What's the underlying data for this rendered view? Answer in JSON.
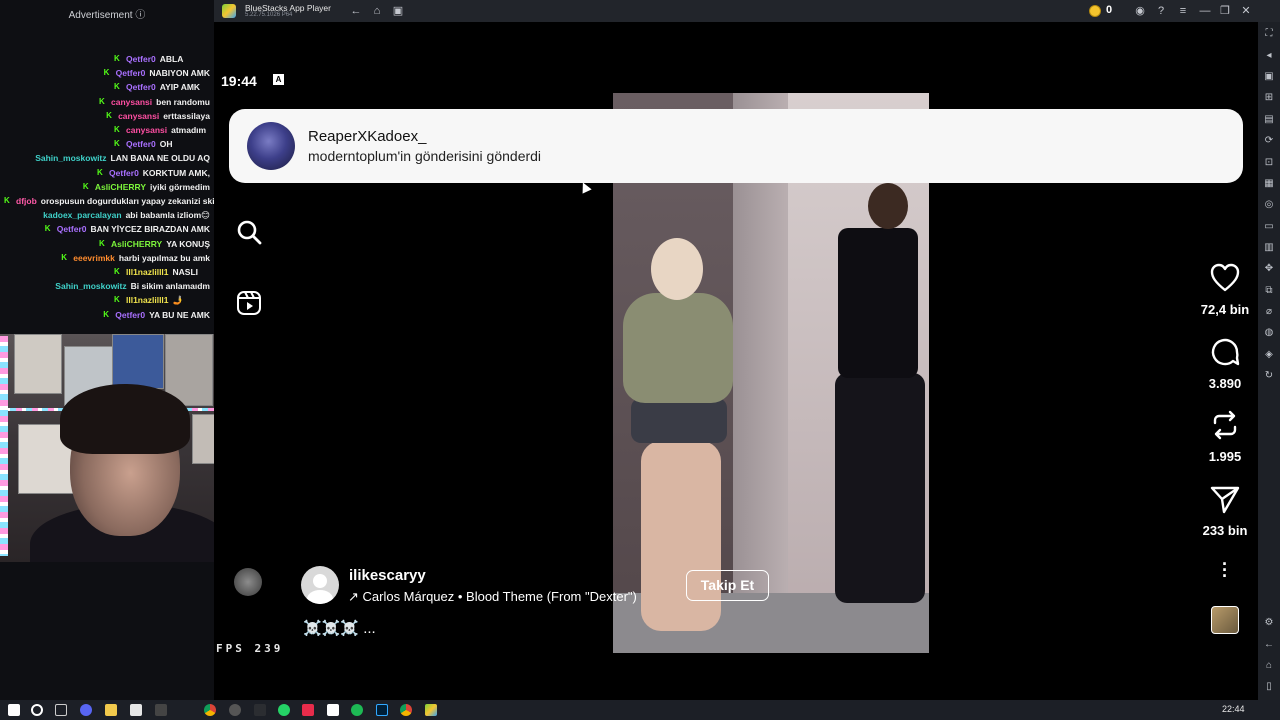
{
  "chat": {
    "ad_label": "Advertisement ⓘ",
    "messages": [
      {
        "user": "Qetfer0",
        "text": "ABLA",
        "color": "#a970ff",
        "badge": true
      },
      {
        "user": "Qetfer0",
        "text": "NABIYON AMK",
        "color": "#a970ff",
        "badge": true
      },
      {
        "user": "Qetfer0",
        "text": "AYIP AMK",
        "color": "#a970ff",
        "badge": true
      },
      {
        "user": "canysansi",
        "text": "ben randomu",
        "color": "#ff4fa3",
        "badge": true
      },
      {
        "user": "canysansi",
        "text": "erttassilaya",
        "color": "#ff4fa3",
        "badge": true
      },
      {
        "user": "canysansi",
        "text": "atmadım",
        "color": "#ff4fa3",
        "badge": true
      },
      {
        "user": "Qetfer0",
        "text": "OH",
        "color": "#a970ff",
        "badge": true
      },
      {
        "user": "Sahin_moskowitz",
        "text": "LAN BANA NE OLDU AQ",
        "color": "#3fd1c9",
        "badge": false
      },
      {
        "user": "Qetfer0",
        "text": "KORKTUM AMK,",
        "color": "#a970ff",
        "badge": true
      },
      {
        "user": "AsliCHERRY",
        "text": "iyiki görmedim",
        "color": "#7cf53b",
        "badge": true
      },
      {
        "user": "dfjob",
        "text": "orospusun dogurdukları yapay zekanizi skim",
        "color": "#ff5aa8",
        "badge": true
      },
      {
        "user": "kadoex_parcalayan",
        "text": "abi babamla izliom😊",
        "color": "#3fd1c9",
        "badge": false
      },
      {
        "user": "Qetfer0",
        "text": "BAN YİYCEZ BIRAZDAN AMK",
        "color": "#a970ff",
        "badge": true
      },
      {
        "user": "AsliCHERRY",
        "text": "YA KONUŞ",
        "color": "#7cf53b",
        "badge": true
      },
      {
        "user": "eeevrimkk",
        "text": "harbi yapılmaz bu amk",
        "color": "#ff8c2e",
        "badge": true
      },
      {
        "user": "lll1nazlilll1",
        "text": "NASLI",
        "color": "#f0e34c",
        "badge": true
      },
      {
        "user": "Sahin_moskowitz",
        "text": "Bi sikim anlamaıdm",
        "color": "#3fd1c9",
        "badge": false
      },
      {
        "user": "lll1nazlilll1",
        "text": "🤳",
        "color": "#f0e34c",
        "badge": true
      },
      {
        "user": "Qetfer0",
        "text": "YA BU NE AMK",
        "color": "#a970ff",
        "badge": true
      }
    ]
  },
  "bluestacks": {
    "title": "BlueStacks App Player",
    "version": "5.22.75.1026 P64",
    "coins": "0",
    "fps_label": "FPS 239"
  },
  "android": {
    "time": "19:44",
    "status_icon": "A"
  },
  "notification": {
    "user": "ReaperXKadoex_",
    "text": "moderntoplum'in gönderisini gönderdi"
  },
  "post": {
    "username": "ilikescaryy",
    "music": "↗ Carlos Márquez • Blood Theme (From \"Dexter\")",
    "follow_label": "Takip Et",
    "caption": "☠️☠️☠️ ..."
  },
  "actions": {
    "likes": "72,4 bin",
    "comments": "3.890",
    "reposts": "1.995",
    "shares": "233 bin"
  },
  "taskbar": {
    "time": "22:44"
  },
  "colors": {
    "chat_bg": "#0e0f13",
    "titlebar": "#22252b",
    "notification_bg": "#f7f7f7",
    "kick_green": "#53fc18"
  }
}
